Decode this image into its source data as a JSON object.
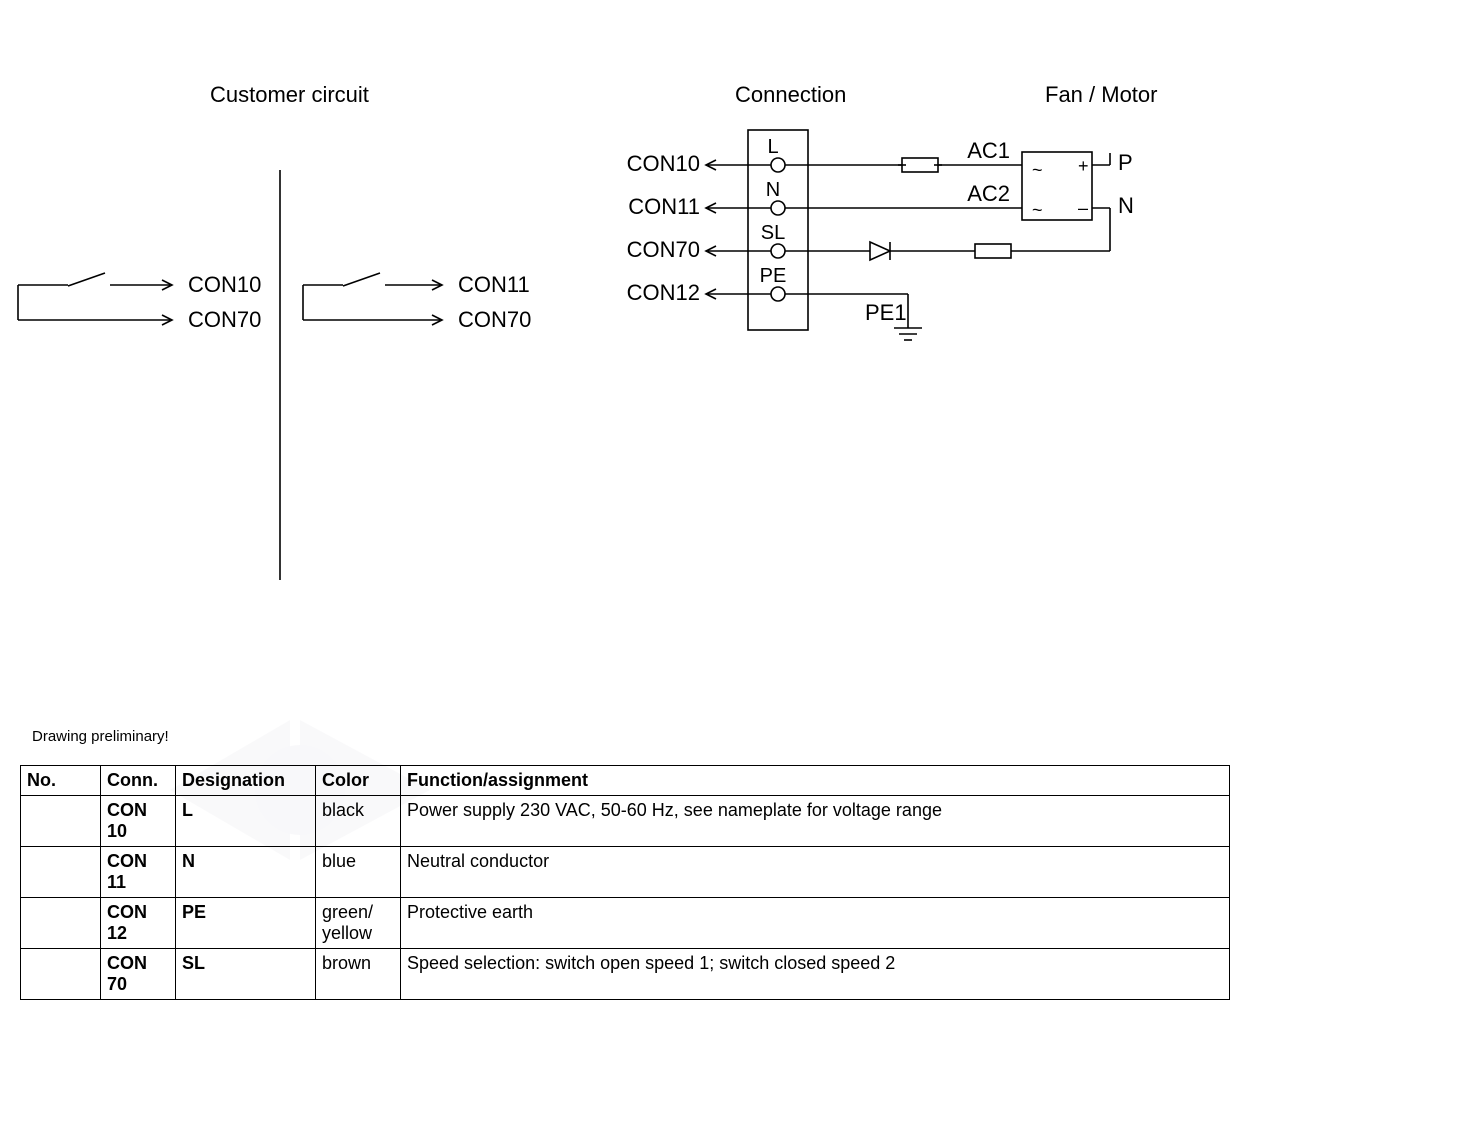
{
  "headings": {
    "customer_circuit": "Customer circuit",
    "connection": "Connection",
    "fan_motor": "Fan / Motor"
  },
  "left_circuit": {
    "sw1_out1": "CON10",
    "sw1_out2": "CON70",
    "sw2_out1": "CON11",
    "sw2_out2": "CON70"
  },
  "connection_block": {
    "rows": [
      {
        "con": "CON10",
        "term": "L"
      },
      {
        "con": "CON11",
        "term": "N"
      },
      {
        "con": "CON70",
        "term": "SL"
      },
      {
        "con": "CON12",
        "term": "PE"
      }
    ],
    "ac1": "AC1",
    "ac2": "AC2",
    "p": "P",
    "n": "N",
    "pe1": "PE1",
    "rect_tl": "~",
    "rect_tr": "+",
    "rect_bl": "~",
    "rect_br": "–"
  },
  "preliminary": "Drawing preliminary!",
  "table": {
    "headers": {
      "no": "No.",
      "conn": "Conn.",
      "designation": "Designation",
      "color": "Color",
      "function": "Function/assignment"
    },
    "rows": [
      {
        "no": "",
        "conn": "CON 10",
        "designation": "L",
        "color": "black",
        "function": "Power supply 230 VAC, 50-60 Hz, see nameplate for voltage range"
      },
      {
        "no": "",
        "conn": "CON 11",
        "designation": "N",
        "color": "blue",
        "function": "Neutral conductor"
      },
      {
        "no": "",
        "conn": "CON 12",
        "designation": "PE",
        "color": "green/ yellow",
        "function": "Protective earth"
      },
      {
        "no": "",
        "conn": "CON 70",
        "designation": "SL",
        "color": "brown",
        "function": "Speed selection: switch open speed 1; switch closed speed 2"
      }
    ]
  }
}
